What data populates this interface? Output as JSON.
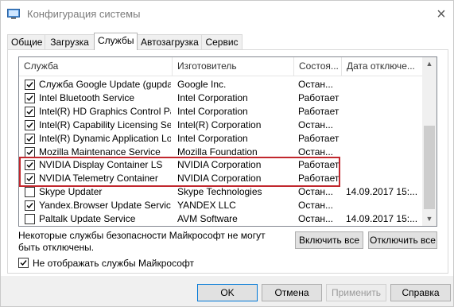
{
  "window": {
    "title": "Конфигурация системы",
    "close_icon": "×"
  },
  "tabs": [
    {
      "label": "Общие"
    },
    {
      "label": "Загрузка"
    },
    {
      "label": "Службы"
    },
    {
      "label": "Автозагрузка"
    },
    {
      "label": "Сервис"
    }
  ],
  "columns": [
    "Служба",
    "Изготовитель",
    "Состоя...",
    "Дата отключе..."
  ],
  "rows": [
    {
      "checked": true,
      "name": "Служба Google Update (gupdat...",
      "vendor": "Google Inc.",
      "status": "Остан...",
      "date": ""
    },
    {
      "checked": true,
      "name": "Intel Bluetooth Service",
      "vendor": "Intel Corporation",
      "status": "Работает",
      "date": ""
    },
    {
      "checked": true,
      "name": "Intel(R) HD Graphics Control Pa...",
      "vendor": "Intel Corporation",
      "status": "Работает",
      "date": ""
    },
    {
      "checked": true,
      "name": "Intel(R) Capability Licensing Ser...",
      "vendor": "Intel(R) Corporation",
      "status": "Остан...",
      "date": ""
    },
    {
      "checked": true,
      "name": "Intel(R) Dynamic Application Lo...",
      "vendor": "Intel Corporation",
      "status": "Работает",
      "date": ""
    },
    {
      "checked": true,
      "name": "Mozilla Maintenance Service",
      "vendor": "Mozilla Foundation",
      "status": "Остан...",
      "date": ""
    },
    {
      "checked": true,
      "name": "NVIDIA Display Container LS",
      "vendor": "NVIDIA Corporation",
      "status": "Работает",
      "date": ""
    },
    {
      "checked": true,
      "name": "NVIDIA Telemetry Container",
      "vendor": "NVIDIA Corporation",
      "status": "Работает",
      "date": ""
    },
    {
      "checked": false,
      "name": "Skype Updater",
      "vendor": "Skype Technologies",
      "status": "Остан...",
      "date": "14.09.2017 15:..."
    },
    {
      "checked": true,
      "name": "Yandex.Browser Update Service",
      "vendor": "YANDEX LLC",
      "status": "Остан...",
      "date": ""
    },
    {
      "checked": false,
      "name": "Paltalk Update Service",
      "vendor": "AVM Software",
      "status": "Остан...",
      "date": "14.09.2017 15:..."
    }
  ],
  "note": "Некоторые службы безопасности Майкрософт не могут быть отключены.",
  "buttons": {
    "enable_all": "Включить все",
    "disable_all": "Отключить все",
    "ok": "OK",
    "cancel": "Отмена",
    "apply": "Применить",
    "help": "Справка"
  },
  "hide_ms": {
    "checked": true,
    "label": "Не отображать службы Майкрософт"
  },
  "colors": {
    "highlight": "#c1272d",
    "accent": "#0078d7"
  }
}
